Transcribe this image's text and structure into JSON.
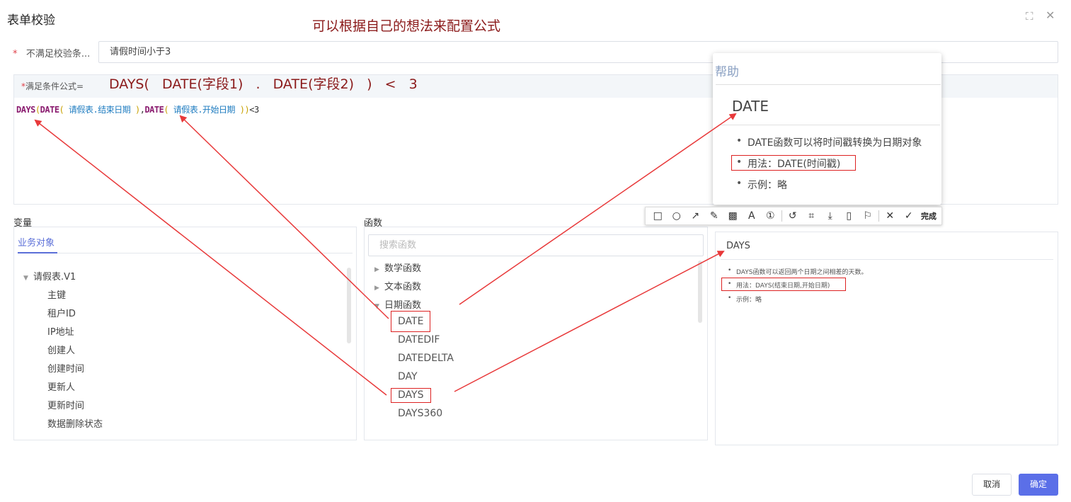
{
  "dialog": {
    "title": "表单校验",
    "annotation": "可以根据自己的想法来配置公式",
    "fullscreen_icon": "fullscreen-icon",
    "close_icon": "close-icon"
  },
  "condition": {
    "required_mark": "*",
    "label": "不满足校验条...",
    "value": "请假时间小于3"
  },
  "formula": {
    "required_mark": "*",
    "label": "满足条件公式=",
    "annotation": "DAYS(   DATE(字段1)   .   DATE(字段2)   )   <   3",
    "tokens": {
      "days": "DAYS",
      "open1": "(",
      "date1": "DATE",
      "open2": "(",
      "field1": "请假表.结束日期",
      "close2": ")",
      "comma": ",",
      "date2": "DATE",
      "open3": "(",
      "field2": "请假表.开始日期",
      "close3": ")",
      "close1": ")",
      "op": "<3"
    }
  },
  "variables": {
    "section_label": "变量",
    "tab": "业务对象",
    "root": "请假表.V1",
    "items": [
      "主键",
      "租户ID",
      "IP地址",
      "创建人",
      "创建时间",
      "更新人",
      "更新时间",
      "数据删除状态"
    ]
  },
  "functions": {
    "section_label": "函数",
    "search_placeholder": "搜索函数",
    "categories": [
      "数学函数",
      "文本函数",
      "日期函数"
    ],
    "date_items": [
      "DATE",
      "DATEDIF",
      "DATEDELTA",
      "DAY",
      "DAYS",
      "DAYS360"
    ]
  },
  "help_popup": {
    "title": "帮助",
    "function_name": "DATE",
    "lines": [
      "DATE函数可以将时间戳转换为日期对象",
      "用法：DATE(时间戳)",
      "示例：略"
    ]
  },
  "annotation_toolbar": {
    "icons": [
      "rectangle-icon",
      "circle-icon",
      "arrow-icon",
      "pen-icon",
      "mosaic-icon",
      "text-icon",
      "number-icon",
      "undo-icon",
      "ocr-icon",
      "download-icon",
      "pin-icon",
      "bookmark-icon",
      "cancel-icon",
      "done-icon"
    ],
    "glyphs": [
      "□",
      "○",
      "↗",
      "✎",
      "▩",
      "A",
      "①",
      "↺",
      "⌗",
      "⤓",
      "▯",
      "⚐",
      "✕",
      "✓"
    ],
    "done_label": "完成"
  },
  "help_panel": {
    "function_name": "DAYS",
    "lines": [
      "DAYS函数可以返回两个日期之间相差的天数。",
      "用法：DAYS(结束日期,开始日期)",
      "示例：略"
    ]
  },
  "footer": {
    "cancel": "取消",
    "ok": "确定"
  },
  "colors": {
    "accent": "#5b6fe8",
    "annotation_red": "#8b1a1a",
    "arrow_red": "#e8393a"
  }
}
